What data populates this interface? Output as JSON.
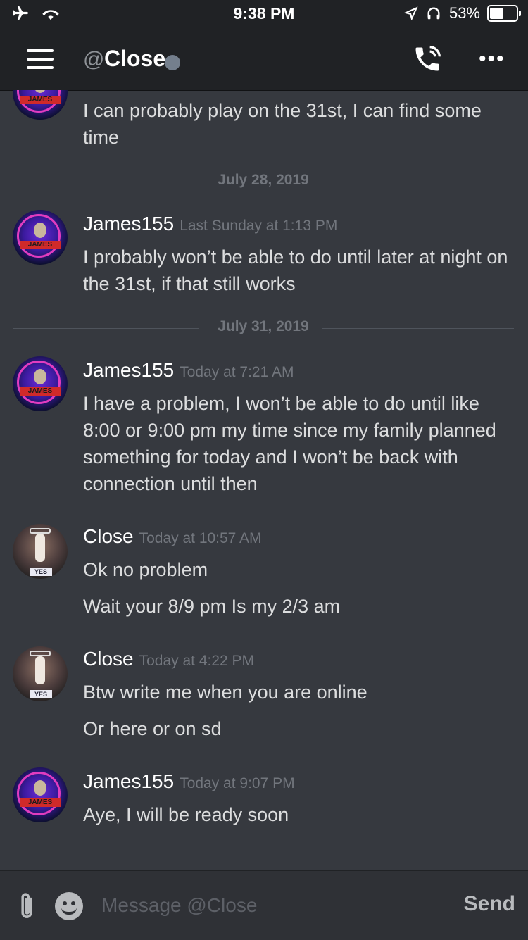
{
  "status_bar": {
    "time": "9:38 PM",
    "battery": "53%",
    "battery_level": 0.53
  },
  "header": {
    "at_symbol": "@",
    "title": "Close"
  },
  "messages": [
    {
      "continuation": "I can probably play on the 31st, I can find some time"
    },
    {
      "divider": "July 28, 2019"
    },
    {
      "author": "James155",
      "timestamp": "Last Sunday at 1:13 PM",
      "lines": [
        "I probably won’t be able to do until later at night on the 31st, if that still works"
      ]
    },
    {
      "divider": "July 31, 2019"
    },
    {
      "author": "James155",
      "timestamp": "Today at 7:21 AM",
      "lines": [
        "I have a problem, I won’t be able to do until like 8:00 or 9:00 pm my time since my family planned something for today and I won’t be back with connection until then"
      ]
    },
    {
      "author": "Close",
      "timestamp": "Today at 10:57 AM",
      "lines": [
        "Ok no problem",
        "Wait your 8/9 pm Is my 2/3 am"
      ]
    },
    {
      "author": "Close",
      "timestamp": "Today at 4:22 PM",
      "lines": [
        "Btw write me when you are online",
        "Or here or on sd"
      ]
    },
    {
      "author": "James155",
      "timestamp": "Today at 9:07 PM",
      "lines": [
        "Aye, I will be ready soon"
      ]
    }
  ],
  "avatar_text": {
    "james": "JAMES",
    "close": "YES"
  },
  "composer": {
    "placeholder": "Message @Close",
    "send_label": "Send"
  },
  "colors": {
    "background": "#36393f",
    "header": "#202225",
    "status_offline": "#747f8d"
  }
}
